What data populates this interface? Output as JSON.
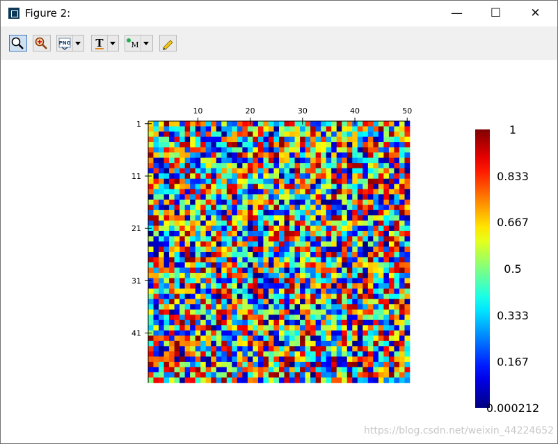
{
  "window": {
    "title": "Figure 2:"
  },
  "controls": {
    "minimize": "—",
    "maximize": "☐",
    "close": "✕"
  },
  "toolbar": {
    "buttons": [
      "zoom-icon",
      "zoom-reset-icon",
      "png-export-icon",
      "text-tool-icon",
      "marker-tool-icon",
      "pencil-icon"
    ]
  },
  "chart_data": {
    "type": "heatmap",
    "rows": 50,
    "cols": 50,
    "colormap": "jet",
    "value_range": [
      0.000212,
      1
    ],
    "x_ticks": [
      "10",
      "20",
      "30",
      "40",
      "50"
    ],
    "y_ticks": [
      "1",
      "11",
      "21",
      "31",
      "41"
    ],
    "colorbar_ticks": [
      "1",
      "0.833",
      "0.667",
      "0.5",
      "0.333",
      "0.167",
      "0.000212"
    ],
    "title": "",
    "xlabel": "",
    "ylabel": ""
  },
  "watermark": "https://blog.csdn.net/weixin_44224652"
}
